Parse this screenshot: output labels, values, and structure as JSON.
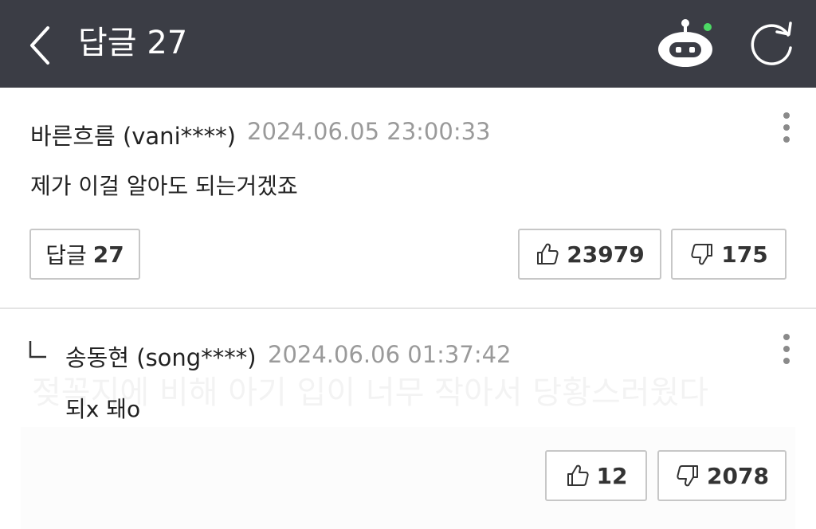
{
  "header": {
    "title": "답글 27"
  },
  "comments": [
    {
      "author": "바른흐름 (vani****)",
      "timestamp": "2024.06.05 23:00:33",
      "text": "제가 이걸 알아도 되는거겠죠",
      "reply_label": "답글",
      "reply_count": "27",
      "likes": "23979",
      "dislikes": "175"
    },
    {
      "reply_marker": "ㄴ",
      "author": "송동현 (song****)",
      "timestamp": "2024.06.06 01:37:42",
      "text": "되x 돼o",
      "likes": "12",
      "dislikes": "2078"
    }
  ],
  "background_text": "젖꼭지에 비해 아기 입이 너무 작아서 당황스러웠다",
  "colors": {
    "header_bg": "#3b3d45",
    "bot_status_dot": "#4cd964",
    "timestamp": "#9a9a9a",
    "button_border": "#c7c7c7"
  },
  "icons": {
    "back": "chevron-left-icon",
    "bot": "bot-icon",
    "refresh": "refresh-icon",
    "more": "more-vertical-icon",
    "like": "thumbs-up-icon",
    "dislike": "thumbs-down-icon"
  }
}
